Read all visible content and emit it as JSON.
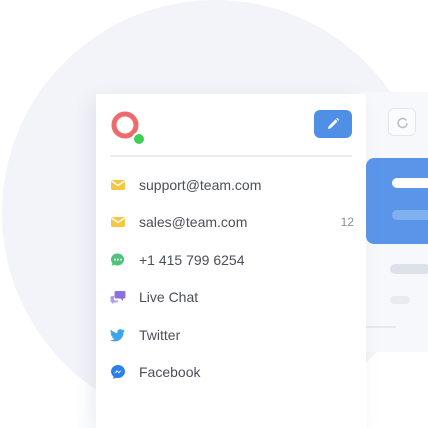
{
  "inbox": {
    "channels": [
      {
        "label": "support@team.com",
        "icon": "email-icon",
        "count": ""
      },
      {
        "label": "sales@team.com",
        "icon": "email-icon",
        "count": "12"
      },
      {
        "label": "+1 415 799 6254",
        "icon": "sms-icon",
        "count": ""
      },
      {
        "label": "Live Chat",
        "icon": "live-chat-icon",
        "count": ""
      },
      {
        "label": "Twitter",
        "icon": "twitter-icon",
        "count": ""
      },
      {
        "label": "Facebook",
        "icon": "messenger-icon",
        "count": ""
      }
    ]
  },
  "colors": {
    "accent": "#4f8fe6",
    "email": "#f7c744",
    "sms": "#4fc37a",
    "live_chat": "#8e6fe0",
    "twitter": "#3fa5e9",
    "messenger": "#2b7fe8",
    "online": "#3ccf5a",
    "avatar": "#ef6b6b"
  }
}
